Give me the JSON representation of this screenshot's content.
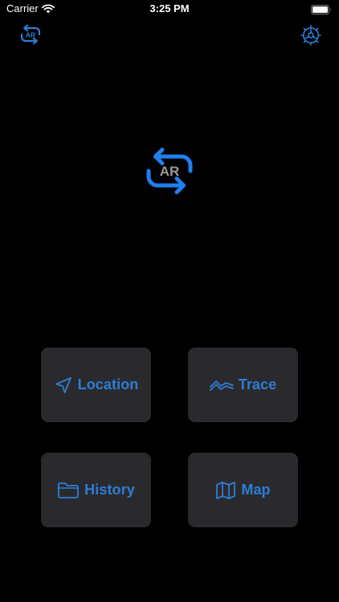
{
  "status_bar": {
    "carrier": "Carrier",
    "time": "3:25 PM",
    "wifi_icon": "wifi-icon",
    "battery_icon": "battery-icon"
  },
  "nav": {
    "left_icon": "ar-toggle-icon",
    "left_icon_text": "AR",
    "right_icon": "gear-icon"
  },
  "logo": {
    "text": "AR",
    "icon": "ar-sync-logo-icon"
  },
  "tiles": [
    {
      "label": "Location",
      "icon": "location-arrow-icon"
    },
    {
      "label": "Trace",
      "icon": "trace-line-icon"
    },
    {
      "label": "History",
      "icon": "folder-icon"
    },
    {
      "label": "Map",
      "icon": "map-icon"
    }
  ],
  "colors": {
    "background": "#000000",
    "tile_background": "#2a2a2e",
    "accent": "#2e7dd7",
    "logo_text": "#9a9a9e"
  }
}
